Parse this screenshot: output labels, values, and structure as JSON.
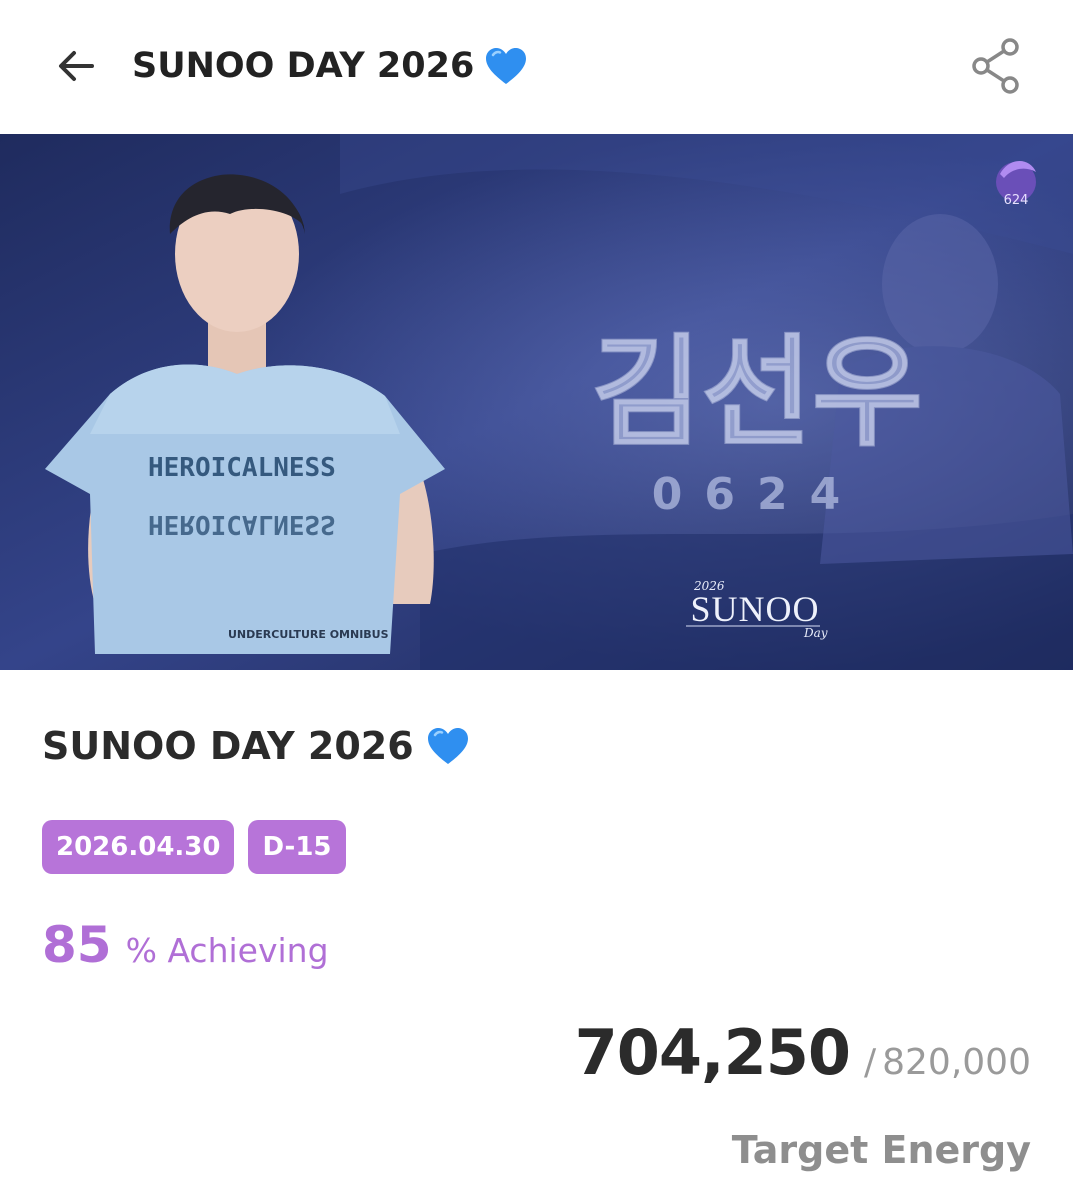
{
  "header": {
    "title": "SUNOO DAY 2026",
    "back_icon": "arrow-left-icon",
    "share_icon": "share-icon",
    "title_emoji": "blue-heart-icon"
  },
  "banner": {
    "name_text": "김선우",
    "birthday_text": "0624",
    "logo_year": "2026",
    "logo_name": "SUNOO",
    "logo_suffix": "Day",
    "corner_logo_text": "624",
    "shirt_text": "HEROICALNESS",
    "shirt_small_text": "UNDERCULTURE OMNIBUS"
  },
  "event": {
    "title": "SUNOO DAY 2026",
    "date": "2026.04.30",
    "dday": "D-15",
    "percent": "85",
    "percent_label": "% Achieving",
    "current_energy": "704,250",
    "separator": "/",
    "target_energy": "820,000",
    "target_label": "Target Energy"
  },
  "colors": {
    "accent": "#b774d9",
    "heart": "#2f8ff0",
    "banner_bg": "#2a3a7a"
  }
}
